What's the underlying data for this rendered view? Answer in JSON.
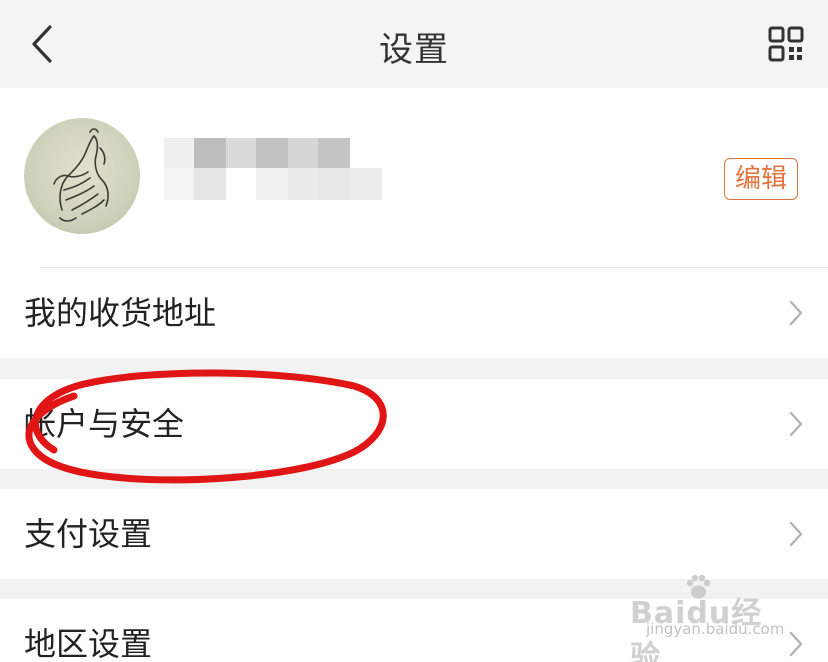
{
  "header": {
    "title": "设置"
  },
  "profile": {
    "edit_label": "编辑"
  },
  "menu": {
    "items": [
      {
        "label": "我的收货地址"
      },
      {
        "label": "帐户与安全"
      },
      {
        "label": "支付设置"
      },
      {
        "label": "地区设置"
      }
    ]
  },
  "watermark": {
    "brand": "Baidu经验",
    "url": "jingyan.baidu.com"
  },
  "colors": {
    "accent": "#e2743f",
    "annotation": "#e01515",
    "background": "#f2f2f2"
  },
  "icons": {
    "back": "chevron-left-icon",
    "qr": "qr-code-icon",
    "row": "chevron-right-icon"
  }
}
